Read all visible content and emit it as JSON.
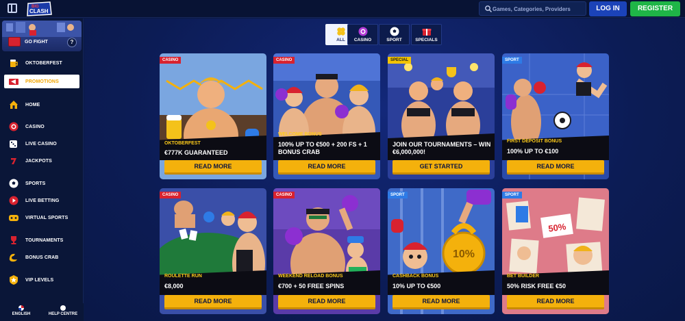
{
  "header": {
    "logo_text": "BIG CLASH",
    "search_placeholder": "Games, Categories, Providers",
    "login_label": "LOG IN",
    "register_label": "REGISTER"
  },
  "colors": {
    "accent_yellow": "#f4b10c",
    "register_green": "#1fb547",
    "login_blue": "#1b43b8",
    "badge_casino": "#d8222f",
    "badge_special": "#f3c300",
    "badge_sport": "#2e7be6",
    "active_promotions": "#f2a500"
  },
  "sidebar": {
    "go_fight": {
      "label": "GO FIGHT",
      "help": "?"
    },
    "items": [
      {
        "label": "OKTOBERFEST",
        "icon": "beer-mug-icon"
      },
      {
        "label": "PROMOTIONS",
        "icon": "megaphone-icon",
        "active": true
      },
      {
        "label": "HOME",
        "icon": "home-icon"
      },
      {
        "label": "CASINO",
        "icon": "casino-chip-icon"
      },
      {
        "label": "LIVE CASINO",
        "icon": "dice-icon"
      },
      {
        "label": "JACKPOTS",
        "icon": "jackpot-seven-icon"
      },
      {
        "label": "SPORTS",
        "icon": "soccer-ball-icon"
      },
      {
        "label": "LIVE BETTING",
        "icon": "live-play-icon"
      },
      {
        "label": "VIRTUAL SPORTS",
        "icon": "virtual-sports-icon"
      },
      {
        "label": "TOURNAMENTS",
        "icon": "trophy-icon"
      },
      {
        "label": "BONUS CRAB",
        "icon": "crab-claw-icon"
      },
      {
        "label": "VIP LEVELS",
        "icon": "vip-shield-icon"
      }
    ],
    "footer": {
      "language": "ENGLISH",
      "help": "HELP CENTRE"
    }
  },
  "tabs": [
    {
      "label": "ALL",
      "icon": "clover-icon",
      "active": true
    },
    {
      "label": "CASINO",
      "icon": "casino-chip-icon"
    },
    {
      "label": "SPORT",
      "icon": "soccer-ball-icon"
    },
    {
      "label": "SPECIALS",
      "icon": "gift-icon"
    }
  ],
  "promotions": [
    {
      "badge": "CASINO",
      "subtitle": "OKTOBERFEST",
      "title": "€777K GUARANTEED",
      "cta": "READ MORE"
    },
    {
      "badge": "CASINO",
      "subtitle": "WELCOME BONUS",
      "title": "100% UP TO €500 + 200 FS + 1 BONUS CRAB",
      "cta": "READ MORE"
    },
    {
      "badge": "SPECIAL",
      "subtitle": "",
      "title": "JOIN OUR TOURNAMENTS – WIN €6,000,000!",
      "cta": "GET STARTED"
    },
    {
      "badge": "SPORT",
      "subtitle": "FIRST DEPOSIT BONUS",
      "title": "100% UP TO €100",
      "cta": "READ MORE"
    },
    {
      "badge": "CASINO",
      "subtitle": "ROULETTE RUN",
      "title": "€8,000",
      "cta": "READ MORE"
    },
    {
      "badge": "CASINO",
      "subtitle": "WEEKEND RELOAD BONUS",
      "title": "€700 + 50 FREE SPINS",
      "cta": "READ MORE"
    },
    {
      "badge": "SPORT",
      "subtitle": "CASHBACK BONUS",
      "title": "10% UP TO €500",
      "cta": "READ MORE"
    },
    {
      "badge": "SPORT",
      "subtitle": "BET BUILDER",
      "title": "50% RISK FREE €50",
      "cta": "READ MORE"
    }
  ],
  "card_art_labels": {
    "cashback_kettlebell": "10%",
    "bet_builder_sign": "50%"
  }
}
